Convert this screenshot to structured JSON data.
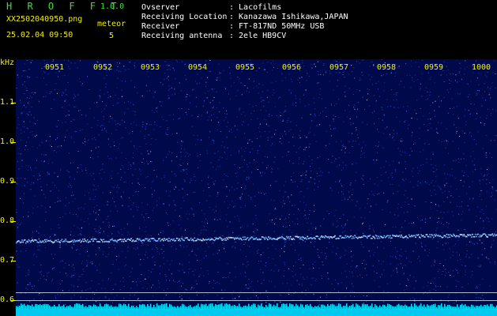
{
  "header": {
    "app_name": "H R O F F T",
    "version": "1.0.0",
    "filename": "XX2502040950.png",
    "datetime": "25.02.04 09:50",
    "meteor_label": "meteor",
    "meteor_count": "5",
    "info": [
      {
        "label": "Ovserver",
        "value": ": Lacofilms"
      },
      {
        "label": "Receiving Location",
        "value": ": Kanazawa Ishikawa,JAPAN"
      },
      {
        "label": "Receiver",
        "value": ": FT-817ND 50MHz USB"
      },
      {
        "label": "Receiving antenna",
        "value": ": 2ele HB9CV"
      }
    ]
  },
  "axis": {
    "y_unit": "kHz",
    "y_ticks": [
      "1.1",
      "1.0",
      "0.9",
      "0.8",
      "0.7",
      "0.6"
    ],
    "x_ticks": [
      "0951",
      "0952",
      "0953",
      "0954",
      "0955",
      "0956",
      "0957",
      "0958",
      "0959",
      "1000"
    ]
  },
  "colors": {
    "background": "#000a4a",
    "noise_bright": "#9fc4ff",
    "signal_trace": "#6ab6ff",
    "baseline": "#00e5ff",
    "label_yellow": "#f2f200",
    "title_green": "#36e33a"
  }
}
